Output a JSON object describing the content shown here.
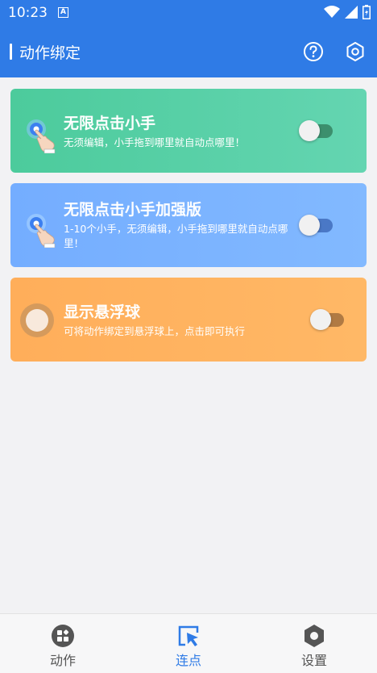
{
  "status_bar": {
    "time": "10:23",
    "notification_badge": "A"
  },
  "app_bar": {
    "title": "动作绑定",
    "help_icon": "help-circle-icon",
    "settings_icon": "hexagon-settings-icon"
  },
  "cards": [
    {
      "title": "无限点击小手",
      "description": "无须编辑，小手拖到哪里就自动点哪里！",
      "color": "#52cc9f",
      "toggle_on": false
    },
    {
      "title": "无限点击小手加强版",
      "description": "1-10个小手，无须编辑，小手拖到哪里就自动点哪里！",
      "color": "#7db4ff",
      "toggle_on": false
    },
    {
      "title": "显示悬浮球",
      "description": "可将动作绑定到悬浮球上，点击即可执行",
      "color": "#ffb35f",
      "toggle_on": false
    }
  ],
  "bottom_nav": {
    "tabs": [
      {
        "label": "动作",
        "icon": "apps-grid-icon",
        "active": false
      },
      {
        "label": "连点",
        "icon": "cursor-click-icon",
        "active": true
      },
      {
        "label": "设置",
        "icon": "hexagon-settings-icon",
        "active": false
      }
    ]
  },
  "colors": {
    "primary": "#2f7be6",
    "background": "#f2f2f4"
  }
}
